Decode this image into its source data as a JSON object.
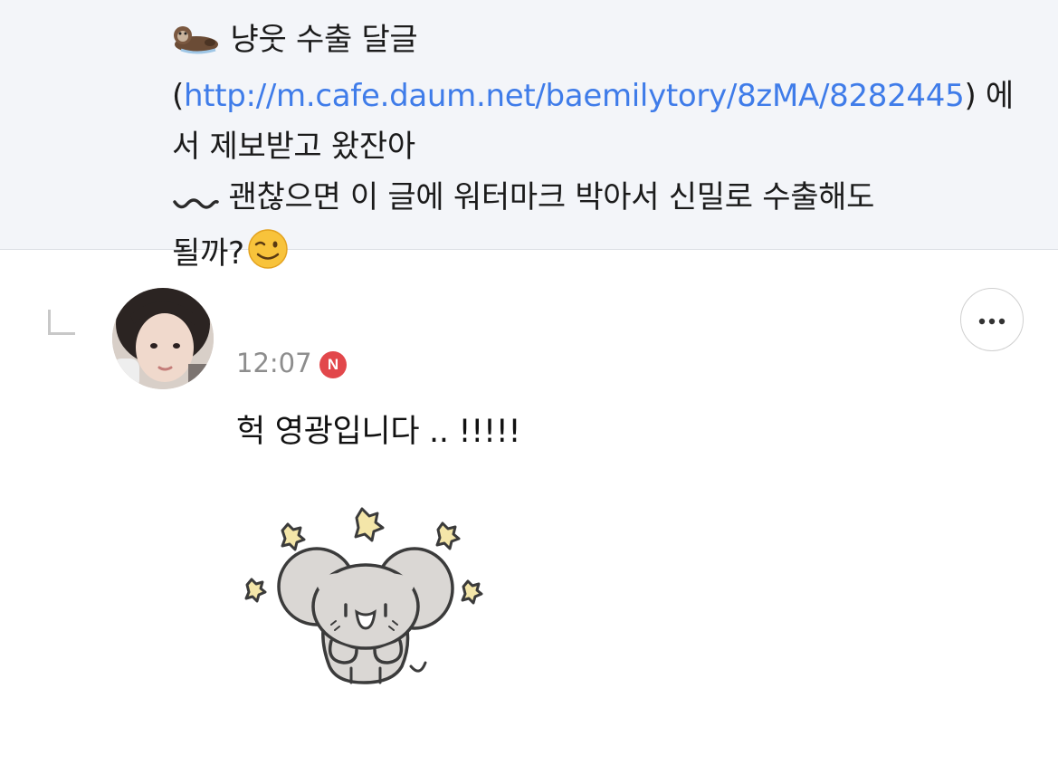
{
  "parent_comment": {
    "emoji_prefix": "otter-emoji",
    "text_before_link": " 냥웃 수출 달글(",
    "link_text": "http://m.cafe.daum.net/baemilytory/8zMA/8282445",
    "text_after_link": ") 에서 제보받고 왔잔아",
    "text_line3": " 괜찮으면 이 글에 워터마크 박아서 신밀로 수출해도",
    "text_line4": "될까?",
    "wavy_icon": "wavy-dash-icon",
    "wink_icon": "winking-face-emoji"
  },
  "reply": {
    "time": "12:07",
    "new_badge": "N",
    "text": "헉 영광입니다 .. !!!!!",
    "sticker": "mouse-sticker",
    "more_icon": "more-dots-icon"
  },
  "colors": {
    "link": "#3f7ce9",
    "badge": "#e2474b",
    "parent_bg": "#f3f5f9"
  }
}
